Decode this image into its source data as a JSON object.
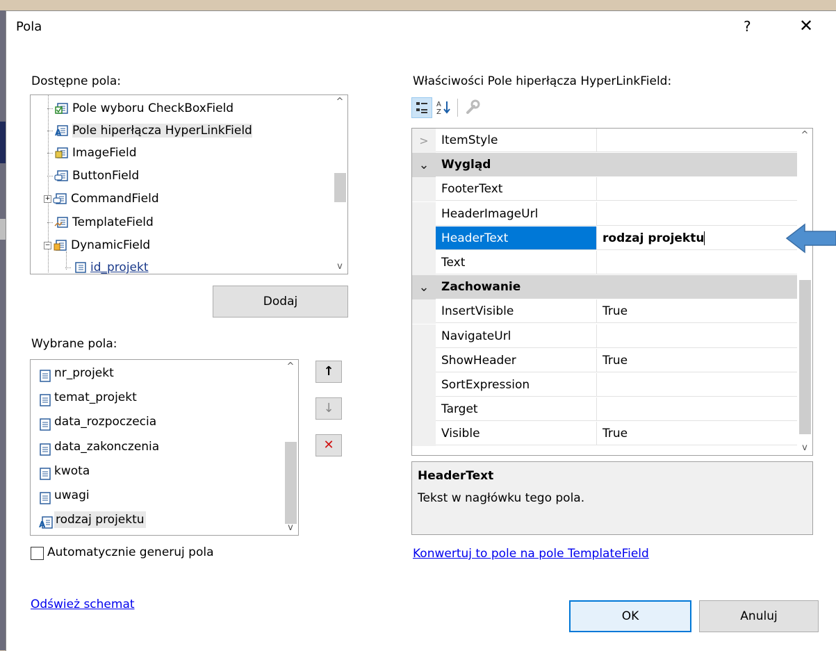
{
  "dialog": {
    "title": "Pola",
    "help_label": "?",
    "close_label": "✕"
  },
  "available": {
    "label": "Dostępne pola:",
    "items": [
      {
        "label": "Pole wyboru CheckBoxField",
        "icon": "checkbox-field-icon"
      },
      {
        "label": "Pole hiperłącza HyperLinkField",
        "icon": "hyperlink-field-icon"
      },
      {
        "label": "ImageField",
        "icon": "image-field-icon"
      },
      {
        "label": "ButtonField",
        "icon": "button-field-icon"
      },
      {
        "label": "CommandField",
        "icon": "command-field-icon"
      },
      {
        "label": "TemplateField",
        "icon": "template-field-icon"
      },
      {
        "label": "DynamicField",
        "icon": "dynamic-field-icon"
      },
      {
        "label": "id_projekt",
        "icon": "field-icon"
      }
    ],
    "add_button": "Dodaj"
  },
  "selected": {
    "label": "Wybrane pola:",
    "items": [
      {
        "label": "nr_projekt",
        "icon": "bound-field-icon"
      },
      {
        "label": "temat_projekt",
        "icon": "bound-field-icon"
      },
      {
        "label": "data_rozpoczecia",
        "icon": "bound-field-icon"
      },
      {
        "label": "data_zakonczenia",
        "icon": "bound-field-icon"
      },
      {
        "label": "kwota",
        "icon": "bound-field-icon"
      },
      {
        "label": "uwagi",
        "icon": "bound-field-icon"
      },
      {
        "label": "rodzaj projektu",
        "icon": "hyperlink-field-icon"
      }
    ],
    "move_up": "↑",
    "move_down": "↓",
    "delete": "✕"
  },
  "auto_generate_label": "Automatycznie generuj pola",
  "auto_generate_checked": false,
  "refresh_link": "Odśwież schemat",
  "properties": {
    "label": "Właściwości Pole hiperłącza HyperLinkField:",
    "rows": [
      {
        "type": "collapsed",
        "glyph": ">",
        "name": "ItemStyle",
        "value": ""
      },
      {
        "type": "category",
        "glyph": "⌄",
        "name": "Wygląd"
      },
      {
        "type": "prop",
        "name": "FooterText",
        "value": ""
      },
      {
        "type": "prop",
        "name": "HeaderImageUrl",
        "value": ""
      },
      {
        "type": "prop",
        "name": "HeaderText",
        "value": "rodzaj projektu",
        "selected": true
      },
      {
        "type": "prop",
        "name": "Text",
        "value": ""
      },
      {
        "type": "category",
        "glyph": "⌄",
        "name": "Zachowanie"
      },
      {
        "type": "prop",
        "name": "InsertVisible",
        "value": "True"
      },
      {
        "type": "prop",
        "name": "NavigateUrl",
        "value": ""
      },
      {
        "type": "prop",
        "name": "ShowHeader",
        "value": "True"
      },
      {
        "type": "prop",
        "name": "SortExpression",
        "value": ""
      },
      {
        "type": "prop",
        "name": "Target",
        "value": ""
      },
      {
        "type": "prop",
        "name": "Visible",
        "value": "True"
      }
    ],
    "description_title": "HeaderText",
    "description_text": "Tekst w nagłówku tego pola."
  },
  "convert_link": "Konwertuj to pole na pole TemplateField",
  "ok_button": "OK",
  "cancel_button": "Anuluj",
  "colors": {
    "selection": "#0078d7",
    "annotation_arrow": "#4f8fcf"
  }
}
